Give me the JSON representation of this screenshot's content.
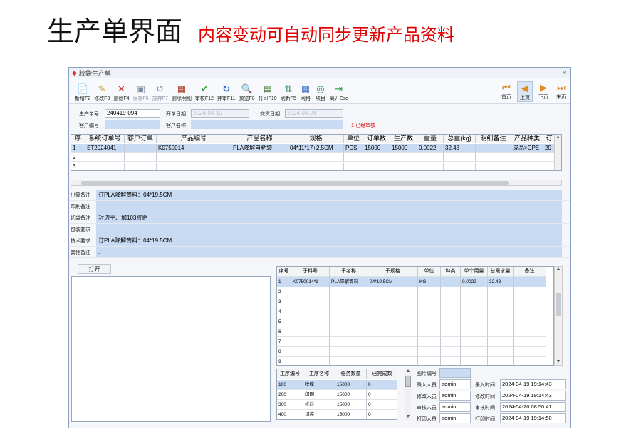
{
  "heading": {
    "title": "生产单界面",
    "subtitle": "内容变动可自动同步更新产品资料"
  },
  "window": {
    "title": "胶袋生产单",
    "close": "×"
  },
  "toolbar": {
    "buttons": [
      {
        "label": "新增F2",
        "icon": "add-doc-icon",
        "disabled": false
      },
      {
        "label": "修改F3",
        "icon": "edit-doc-icon",
        "disabled": false
      },
      {
        "label": "删除F4",
        "icon": "delete-x-icon",
        "disabled": false
      },
      {
        "label": "保存F6",
        "icon": "save-icon",
        "disabled": true
      },
      {
        "label": "放弃F7",
        "icon": "undo-icon",
        "disabled": true
      },
      {
        "label": "删除明细",
        "icon": "delete-detail-icon",
        "disabled": false
      },
      {
        "label": "审核F12",
        "icon": "check-icon",
        "disabled": false
      },
      {
        "label": "弃审F11",
        "icon": "refresh-icon",
        "disabled": false
      },
      {
        "label": "预览F8",
        "icon": "preview-icon",
        "disabled": false
      },
      {
        "label": "打印F10",
        "icon": "print-icon",
        "disabled": false
      },
      {
        "label": "刷新F5",
        "icon": "refresh-arrows-icon",
        "disabled": false
      },
      {
        "label": "网格",
        "icon": "grid-icon",
        "disabled": false
      },
      {
        "label": "项目",
        "icon": "project-icon",
        "disabled": false
      },
      {
        "label": "离开Esc",
        "icon": "exit-icon",
        "disabled": false
      }
    ],
    "nav": [
      {
        "label": "首页",
        "icon": "first-page-icon"
      },
      {
        "label": "上页",
        "icon": "prev-page-icon"
      },
      {
        "label": "下页",
        "icon": "next-page-icon"
      },
      {
        "label": "末页",
        "icon": "last-page-icon"
      }
    ]
  },
  "form": {
    "order_no_label": "生产单号",
    "order_no": "240419-094",
    "open_date_label": "开单日期",
    "open_date": "2024-04-19",
    "delivery_date_label": "交货日期",
    "delivery_date": "2024-04-24",
    "customer_code_label": "客户编号",
    "customer_name_label": "客户名称",
    "status": "1-已经审核"
  },
  "grid1": {
    "headers": [
      "序",
      "系统订单号",
      "客户订单",
      "产品编号",
      "产品名称",
      "规格",
      "单位",
      "订单数",
      "生产数",
      "重量",
      "总重(kg)",
      "明细备注",
      "产品种类",
      "订"
    ],
    "rows": [
      [
        "1",
        "ST2024041",
        "",
        "K0750014",
        "PLA降解自粘袋",
        "04*11*17+2.5CM",
        "PCS",
        "15000",
        "15000",
        "0.0022",
        "32.43",
        "",
        "成品>CPE",
        "20"
      ],
      [
        "2",
        "",
        "",
        "",
        "",
        "",
        "",
        "",
        "",
        "",
        "",
        "",
        "",
        ""
      ],
      [
        "3",
        "",
        "",
        "",
        "",
        "",
        "",
        "",
        "",
        "",
        "",
        "",
        "",
        ""
      ]
    ]
  },
  "notes": [
    {
      "label": "出筒备注",
      "value": "订PLA降解筒料：04*19.5CM"
    },
    {
      "label": "印刷备注",
      "value": ""
    },
    {
      "label": "切袋备注",
      "value": "封边平、加103胶贴"
    },
    {
      "label": "包装要求",
      "value": ""
    },
    {
      "label": "技术要求",
      "value": "订PLA降解筒料：04*19.5CM"
    },
    {
      "label": "其他备注",
      "value": "."
    }
  ],
  "open_button": "打开",
  "grid2": {
    "headers": [
      "序号",
      "子料号",
      "子名称",
      "子规格",
      "单位",
      "种类",
      "单个用量",
      "总需求量",
      "备注"
    ],
    "rows": [
      [
        "1",
        "K0750014*1",
        "PLA降解筒料",
        "04*19.5CM",
        "KG",
        "",
        "0.0022",
        "32.43",
        ""
      ],
      [
        "2",
        "",
        "",
        "",
        "",
        "",
        "",
        "",
        ""
      ],
      [
        "3",
        "",
        "",
        "",
        "",
        "",
        "",
        "",
        ""
      ],
      [
        "4",
        "",
        "",
        "",
        "",
        "",
        "",
        "",
        ""
      ],
      [
        "5",
        "",
        "",
        "",
        "",
        "",
        "",
        "",
        ""
      ],
      [
        "6",
        "",
        "",
        "",
        "",
        "",
        "",
        "",
        ""
      ],
      [
        "7",
        "",
        "",
        "",
        "",
        "",
        "",
        "",
        ""
      ],
      [
        "8",
        "",
        "",
        "",
        "",
        "",
        "",
        "",
        ""
      ],
      [
        "9",
        "",
        "",
        "",
        "",
        "",
        "",
        "",
        ""
      ]
    ]
  },
  "grid3": {
    "headers": [
      "工序编号",
      "工序名称",
      "任务数量",
      "已完成数"
    ],
    "rows": [
      [
        "100",
        "吹膜",
        "15000",
        "0"
      ],
      [
        "200",
        "印刷",
        "15000",
        "0"
      ],
      [
        "300",
        "折料",
        "15000",
        "0"
      ],
      [
        "400",
        "切袋",
        "15000",
        "0"
      ]
    ]
  },
  "info": {
    "image_no_label": "图片编号",
    "entry_user_label": "录入人员",
    "entry_user": "admin",
    "entry_time_label": "录入时间",
    "entry_time": "2024-04-19 19:14:43",
    "modify_user_label": "修改人员",
    "modify_user": "admin",
    "modify_time_label": "修改时间",
    "modify_time": "2024-04-19 19:14:43",
    "audit_user_label": "审核人员",
    "audit_user": "admin",
    "audit_time_label": "审核时间",
    "audit_time": "2024-04-20 08:50:41",
    "print_user_label": "打印人员",
    "print_user": "admin",
    "print_time_label": "打印时间",
    "print_time": "2024-04-19 19:14:50"
  }
}
